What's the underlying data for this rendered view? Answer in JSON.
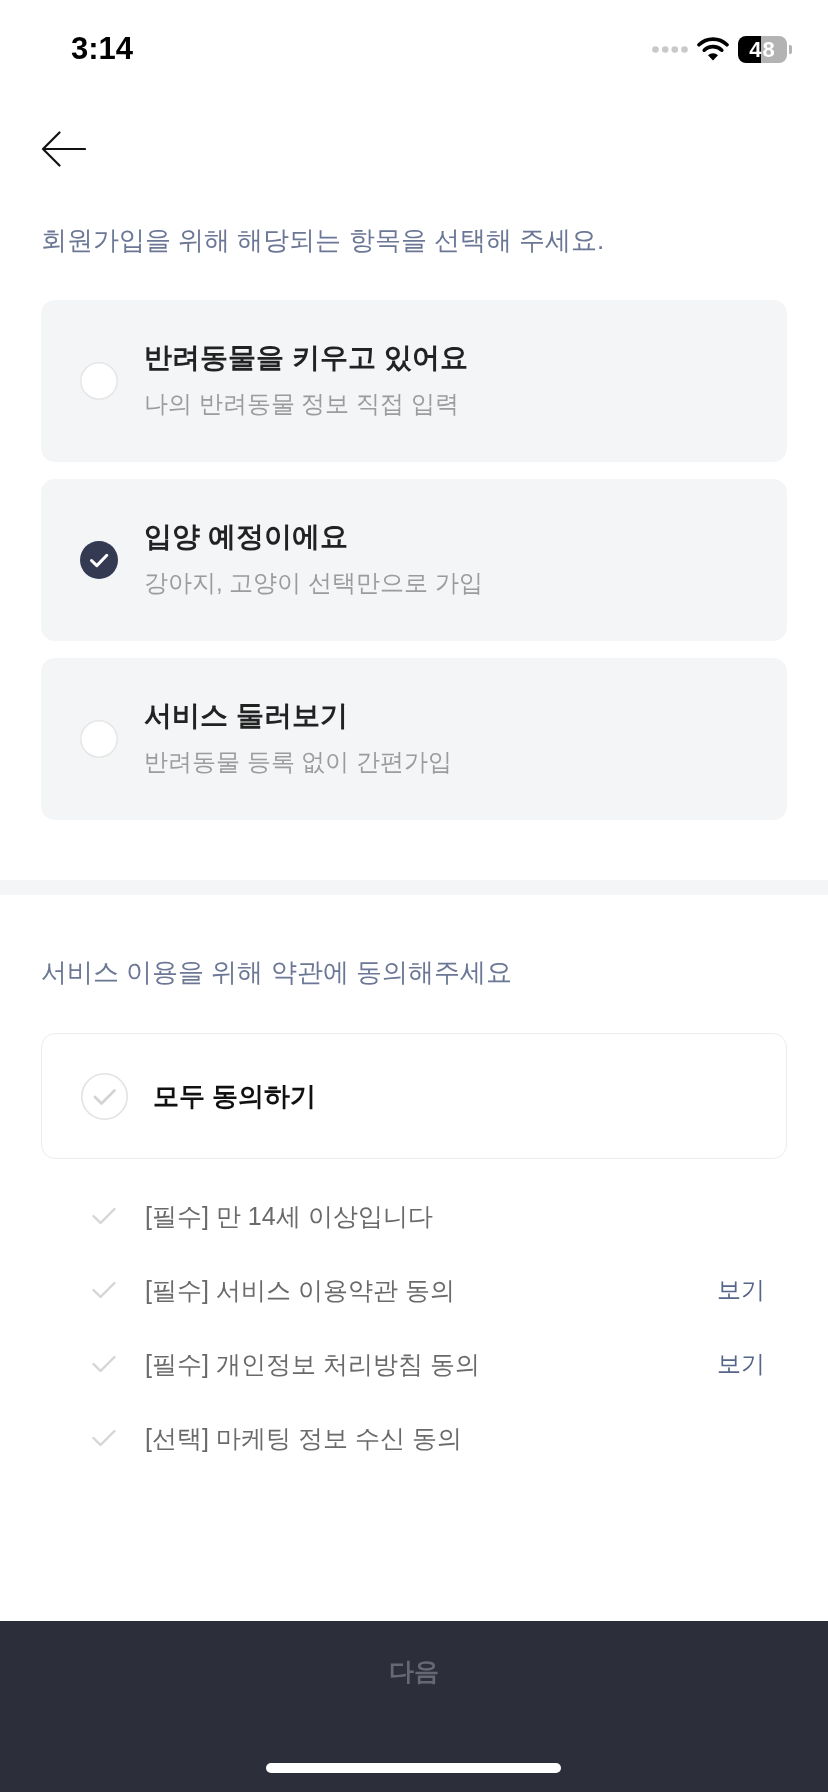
{
  "status_bar": {
    "time": "3:14",
    "battery": "48"
  },
  "signup": {
    "prompt": "회원가입을 위해 해당되는 항목을 선택해 주세요.",
    "options": [
      {
        "title": "반려동물을 키우고 있어요",
        "subtitle": "나의 반려동물 정보 직접 입력",
        "selected": false
      },
      {
        "title": "입양 예정이에요",
        "subtitle": "강아지, 고양이 선택만으로 가입",
        "selected": true
      },
      {
        "title": "서비스 둘러보기",
        "subtitle": "반려동물 등록 없이 간편가입",
        "selected": false
      }
    ]
  },
  "terms": {
    "prompt": "서비스 이용을 위해 약관에 동의해주세요",
    "agree_all": {
      "label": "모두 동의하기",
      "checked": false
    },
    "items": [
      {
        "label": "[필수] 만 14세 이상입니다",
        "checked": false
      },
      {
        "label": "[필수] 서비스 이용약관 동의",
        "checked": false,
        "link": "보기"
      },
      {
        "label": "[필수] 개인정보 처리방침 동의",
        "checked": false,
        "link": "보기"
      },
      {
        "label": "[선택] 마케팅 정보 수신 동의",
        "checked": false
      }
    ]
  },
  "next_button": {
    "label": "다음",
    "disabled": true
  }
}
